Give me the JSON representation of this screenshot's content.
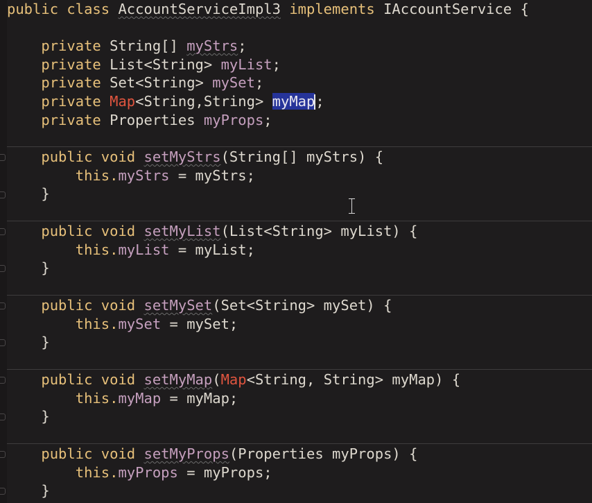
{
  "editor": {
    "class_decl": {
      "kw_public": "public",
      "kw_class": "class",
      "class_name": "AccountServiceImpl3",
      "kw_implements": "implements",
      "interface_name": "IAccountService",
      "brace": "{"
    },
    "fields": [
      {
        "modifier": "private",
        "type": "String[]",
        "name": "myStrs",
        "end": ";"
      },
      {
        "modifier": "private",
        "type": "List<String>",
        "name": "myList",
        "end": ";"
      },
      {
        "modifier": "private",
        "type": "Set<String>",
        "name": "mySet",
        "end": ";"
      },
      {
        "modifier": "private",
        "type_red": "Map",
        "type_rest": "<String,String>",
        "name": "myMap",
        "end": ";"
      },
      {
        "modifier": "private",
        "type": "Properties",
        "name": "myProps",
        "end": ";"
      }
    ],
    "methods": [
      {
        "sig_kw": "public void",
        "name": "setMyStrs",
        "params": "(String[] myStrs) {",
        "this": "this.",
        "field": "myStrs",
        "assign": " = myStrs;",
        "close": "}"
      },
      {
        "sig_kw": "public void",
        "name": "setMyList",
        "params": "(List<String> myList) {",
        "this": "this.",
        "field": "myList",
        "assign": " = myList;",
        "close": "}"
      },
      {
        "sig_kw": "public void",
        "name": "setMySet",
        "params": "(Set<String> mySet) {",
        "this": "this.",
        "field": "mySet",
        "assign": " = mySet;",
        "close": "}"
      },
      {
        "sig_kw": "public void",
        "name": "setMyMap",
        "params_red": "Map",
        "params": "<String, String> myMap) {",
        "this": "this.",
        "field": "myMap",
        "assign": " = myMap;",
        "close": "}"
      },
      {
        "sig_kw": "public void",
        "name": "setMyProps",
        "params": "(Properties myProps) {",
        "this": "this.",
        "field": "myProps",
        "assign": " = myProps;",
        "close": "}"
      }
    ],
    "colors": {
      "background": "#1e1c1d",
      "keyword": "#e7c07a",
      "field": "#c6a0bf",
      "error_type": "#e0553f",
      "selection": "#26349a"
    }
  }
}
